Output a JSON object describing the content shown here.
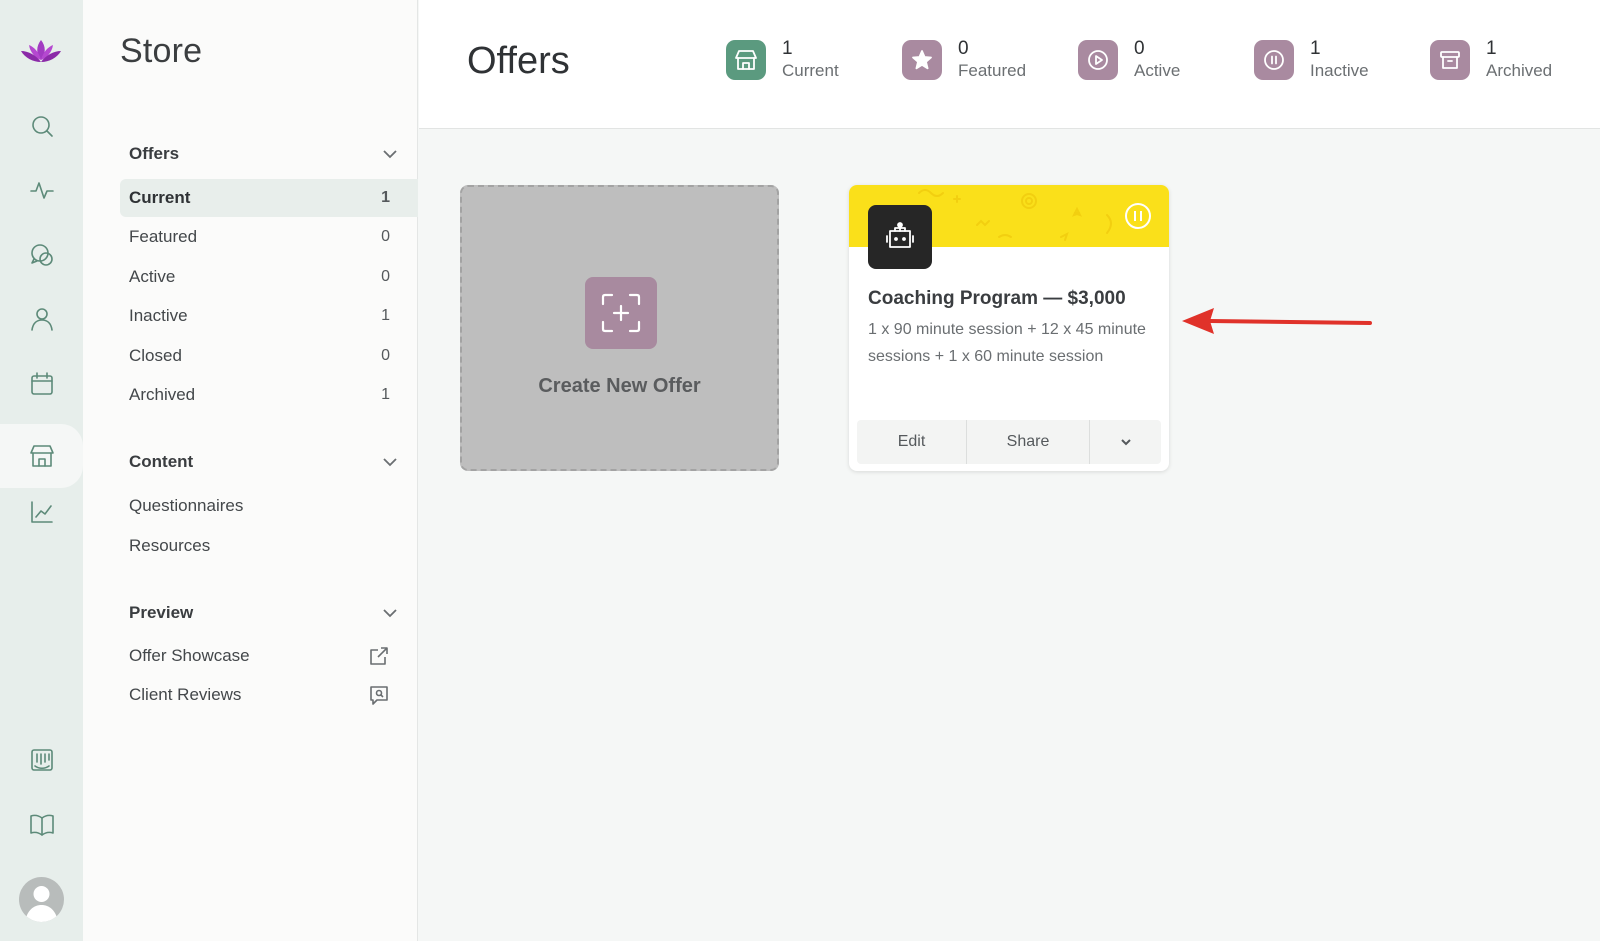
{
  "rail": {
    "icons": [
      "lotus-logo-icon",
      "search-icon",
      "activity-icon",
      "chat-icon",
      "user-icon",
      "calendar-icon",
      "store-icon",
      "chart-icon",
      "board-icon",
      "book-icon",
      "avatar"
    ]
  },
  "sidebar": {
    "title": "Store",
    "offers_section": {
      "label": "Offers",
      "items": [
        {
          "label": "Current",
          "count": "1"
        },
        {
          "label": "Featured",
          "count": "0"
        },
        {
          "label": "Active",
          "count": "0"
        },
        {
          "label": "Inactive",
          "count": "1"
        },
        {
          "label": "Closed",
          "count": "0"
        },
        {
          "label": "Archived",
          "count": "1"
        }
      ]
    },
    "content_section": {
      "label": "Content",
      "items": [
        {
          "label": "Questionnaires"
        },
        {
          "label": "Resources"
        }
      ]
    },
    "preview_section": {
      "label": "Preview",
      "items": [
        {
          "label": "Offer Showcase",
          "icon": "external-link-icon"
        },
        {
          "label": "Client Reviews",
          "icon": "review-icon"
        }
      ]
    }
  },
  "header": {
    "title": "Offers",
    "stats": [
      {
        "value": "1",
        "label": "Current",
        "color": "#5b9a7f",
        "icon": "store-icon"
      },
      {
        "value": "0",
        "label": "Featured",
        "color": "#a98aa0",
        "icon": "star-icon"
      },
      {
        "value": "0",
        "label": "Active",
        "color": "#a98aa0",
        "icon": "play-icon"
      },
      {
        "value": "1",
        "label": "Inactive",
        "color": "#a98aa0",
        "icon": "pause-icon"
      },
      {
        "value": "1",
        "label": "Archived",
        "color": "#a98aa0",
        "icon": "archive-icon"
      }
    ]
  },
  "create_card": {
    "label": "Create New Offer"
  },
  "offer_card": {
    "title": "Coaching Program — $3,000",
    "description": "1 x 90 minute session + 12 x 45 minute sessions + 1 x 60 minute session",
    "banner_color": "#fae01a",
    "actions": {
      "edit": "Edit",
      "share": "Share"
    }
  },
  "colors": {
    "accent_green": "#5b9a7f",
    "accent_mauve": "#a98aa0",
    "annotation_arrow": "#e0322a"
  }
}
